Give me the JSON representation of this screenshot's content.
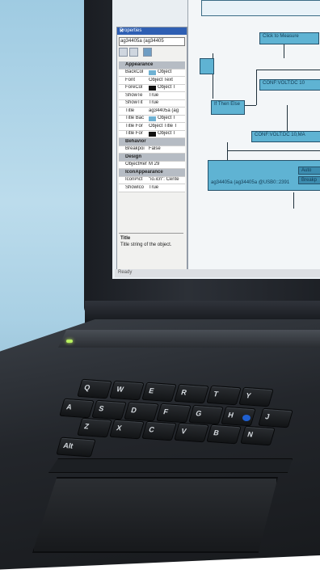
{
  "properties_panel": {
    "title": "Properties",
    "close_glyph": "✕",
    "object_selector": "ag34405a (ag34405",
    "rows": [
      {
        "kind": "category",
        "label": "Appearance"
      },
      {
        "kind": "prop",
        "key": "BackCol",
        "value": "Object",
        "swatch": "#6fb2d3"
      },
      {
        "kind": "prop",
        "key": "Font",
        "value": "Object Text"
      },
      {
        "kind": "prop",
        "key": "ForeCol",
        "value": "Object T",
        "swatch": "#111111"
      },
      {
        "kind": "prop",
        "key": "ShowTe",
        "value": "True"
      },
      {
        "kind": "prop",
        "key": "ShowTit",
        "value": "True"
      },
      {
        "kind": "prop",
        "key": "Title",
        "value": "ag34405a (ag"
      },
      {
        "kind": "prop",
        "key": "Title Bac",
        "value": "Object T",
        "swatch": "#6fb2d3"
      },
      {
        "kind": "prop",
        "key": "Title For",
        "value": "Object Title T"
      },
      {
        "kind": "prop",
        "key": "Title For",
        "value": "Object T",
        "swatch": "#111111"
      },
      {
        "kind": "category",
        "label": "Behavior"
      },
      {
        "kind": "prop",
        "key": "Breakpoi",
        "value": "False"
      },
      {
        "kind": "category",
        "label": "Design"
      },
      {
        "kind": "prop",
        "key": "ObjectRef",
        "value": "M 29"
      },
      {
        "kind": "category",
        "label": "IconAppearance"
      },
      {
        "kind": "prop",
        "key": "IconPict",
        "value": "\"io.icn\": Cente"
      },
      {
        "kind": "prop",
        "key": "ShowIco",
        "value": "True"
      }
    ],
    "description_title": "Title",
    "description_text": "Title string of the object."
  },
  "status_bar": {
    "text": "Ready"
  },
  "flowchart": {
    "nodes": [
      {
        "id": "measure",
        "label": "Click to Measure"
      },
      {
        "id": "config1",
        "label": "CONF:VOLT:DC 10"
      },
      {
        "id": "ifthen",
        "label": "If Then Else"
      },
      {
        "id": "config2",
        "label": "CONF:VOLT:DC 10,MA"
      },
      {
        "id": "instrument",
        "label": "ag34405a (ag34405a @USB0::2391"
      },
      {
        "id": "small_a",
        "label": "Auto"
      },
      {
        "id": "small_b",
        "label": "Breakp"
      }
    ]
  },
  "keyboard": {
    "keys": [
      "Q",
      "W",
      "E",
      "R",
      "T",
      "Y",
      "A",
      "S",
      "D",
      "F",
      "G",
      "H",
      "J",
      "Z",
      "X",
      "C",
      "V",
      "B",
      "N",
      "Alt"
    ]
  },
  "colors": {
    "background": "#a9d0e4",
    "node_fill": "#5fb3d3",
    "trackpoint": "#1f5fd0",
    "panel_title": "#2f5fb3"
  }
}
